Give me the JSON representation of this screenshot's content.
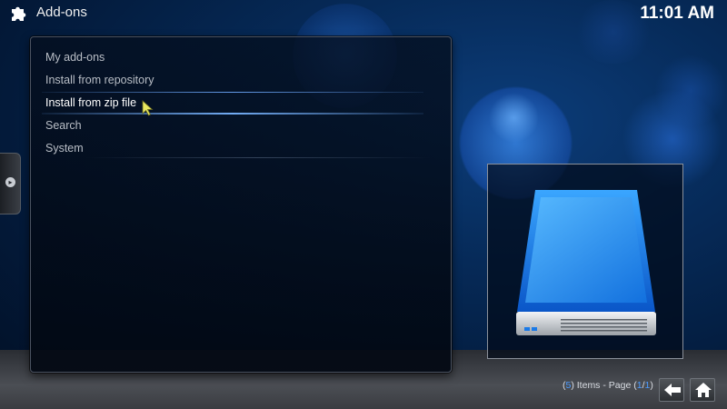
{
  "header": {
    "title": "Add-ons",
    "clock": "11:01 AM"
  },
  "menu": {
    "items": [
      {
        "label": "My add-ons",
        "focused": false
      },
      {
        "label": "Install from repository",
        "focused": false
      },
      {
        "label": "Install from zip file",
        "focused": true
      },
      {
        "label": "Search",
        "focused": false
      },
      {
        "label": "System",
        "focused": false
      }
    ]
  },
  "footer": {
    "count": "5",
    "items_text": "Items - Page",
    "page_current": "1",
    "page_total": "1"
  },
  "icons": {
    "header": "puzzle-piece-icon",
    "preview": "hard-drive-icon",
    "back": "back-arrow-icon",
    "home": "home-icon"
  },
  "colors": {
    "accent": "#4a9aff",
    "focus_line": "#78b4ff"
  }
}
